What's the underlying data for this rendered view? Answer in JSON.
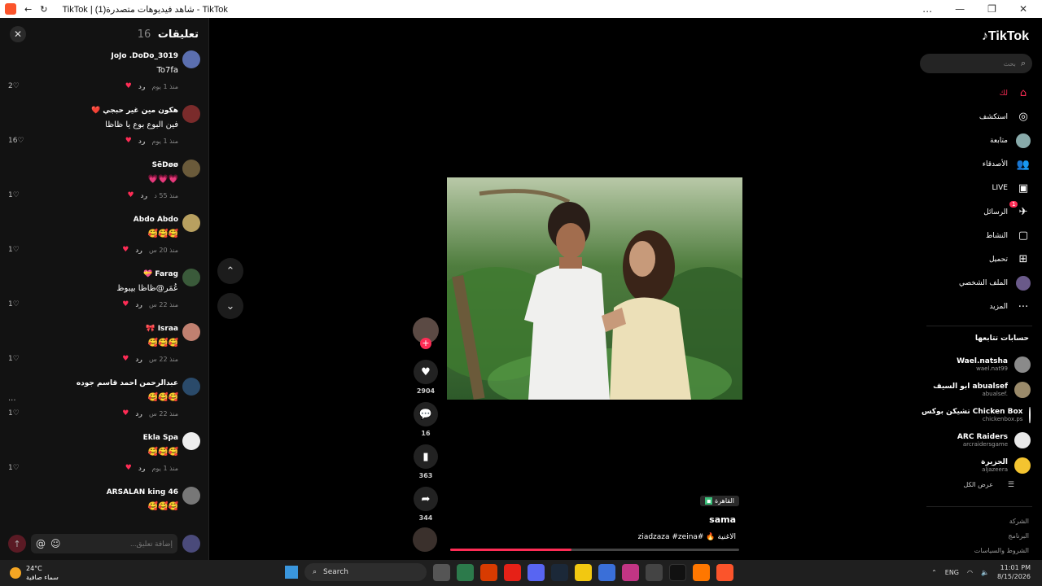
{
  "browser": {
    "title": "TikTok | شاهد فيديوهات متصدرة(1) - TikTok",
    "controls": [
      "…",
      "—",
      "❐",
      "✕"
    ]
  },
  "comments": {
    "title": "تعليقات",
    "count": "16",
    "input_placeholder": "إضافة تعليق...",
    "items": [
      {
        "user": "JoJo .DoDo_3019",
        "text": "To7fa",
        "time": "منذ 1 يوم",
        "reply": "رد",
        "likes": "2",
        "avatar_color": "#5b6fb0"
      },
      {
        "user": "هكون مين غير حبجي ❤️",
        "text": "فين البوع بوع يا ظاظا",
        "time": "منذ 1 يوم",
        "reply": "رد",
        "likes": "16",
        "avatar_color": "#7a2b2b"
      },
      {
        "user": "SēDøø",
        "text": "💗💗💗",
        "time": "منذ 55 د",
        "reply": "رد",
        "likes": "1",
        "avatar_color": "#6a5a3a"
      },
      {
        "user": "Abdo Abdo",
        "text": "🥰🥰🥰",
        "time": "منذ 20 س",
        "reply": "رد",
        "likes": "1",
        "avatar_color": "#b8a060"
      },
      {
        "user": "Farag 💝",
        "text": "عُمَر@ظاظا بيبوظ",
        "time": "منذ 22 س",
        "reply": "رد",
        "likes": "1",
        "avatar_color": "#3a5a3a"
      },
      {
        "user": "Israa 🎀",
        "text": "🥰🥰🥰",
        "time": "منذ 22 س",
        "reply": "رد",
        "likes": "1",
        "avatar_color": "#c08070"
      },
      {
        "user": "عبدالرحمن احمد قاسم جوده",
        "text": "🥰🥰🥰",
        "time": "منذ 22 س",
        "reply": "رد",
        "likes": "1",
        "avatar_color": "#2a4a6a",
        "more": "..."
      },
      {
        "user": "Ekla Spa",
        "text": "🥰🥰🥰",
        "time": "منذ 1 يوم",
        "reply": "رد",
        "likes": "1",
        "avatar_color": "#eeeeee"
      },
      {
        "user": "ARSALAN king 46",
        "text": "🥰🥰🥰",
        "time": "",
        "reply": "",
        "likes": "",
        "avatar_color": "#777777"
      }
    ]
  },
  "video": {
    "location": "القاهرة",
    "author": "sama",
    "caption": "الاغنية 🔥 #ziadzaza #zeina",
    "progress": 0.42,
    "likes": "2904",
    "comments": "16",
    "saves": "363",
    "shares": "344"
  },
  "sidebar": {
    "logo": "TikTok",
    "search_placeholder": "بحث",
    "nav": [
      {
        "label": "لك",
        "icon": "home-icon",
        "glyph": "⌂",
        "active": true
      },
      {
        "label": "استكشف",
        "icon": "compass-icon",
        "glyph": "◎"
      },
      {
        "label": "متابعة",
        "icon": "avatar-icon",
        "glyph": ""
      },
      {
        "label": "الأصدقاء",
        "icon": "friends-icon",
        "glyph": "👥"
      },
      {
        "label": "LIVE",
        "icon": "live-icon",
        "glyph": "▣"
      },
      {
        "label": "الرسائل",
        "icon": "messages-icon",
        "glyph": "✈",
        "badge": "1"
      },
      {
        "label": "النشاط",
        "icon": "activity-icon",
        "glyph": "▢"
      },
      {
        "label": "تحميل",
        "icon": "upload-icon",
        "glyph": "⊞"
      },
      {
        "label": "الملف الشخصي",
        "icon": "profile-icon",
        "glyph": ""
      },
      {
        "label": "المزيد",
        "icon": "more-icon",
        "glyph": "···"
      }
    ],
    "following_title": "حسابات تتابعها",
    "following": [
      {
        "name": "Wael.natsha",
        "handle": "wael.nat99",
        "color": "#8a8a8a"
      },
      {
        "name": "ابو السيف abualsef",
        "handle": "abualsef.",
        "color": "#9a8a6a"
      },
      {
        "name": "تشيكن بوكس Chicken Box",
        "handle": "chickenbox.ps",
        "color": "#f2f2f2"
      },
      {
        "name": "ARC Raiders",
        "handle": "arcraidersgame",
        "color": "#e8e8e8"
      },
      {
        "name": "الجزيرة",
        "handle": "aljazeera",
        "color": "#f4c430"
      }
    ],
    "see_all": "عرض الكل",
    "footer": [
      "الشركة",
      "البرنامج",
      "الشروط والسياسات"
    ]
  },
  "taskbar": {
    "temp": "24°C",
    "weather": "سماء صافية",
    "search": "Search",
    "lang": "ENG",
    "time": "11:01 PM",
    "date": "8/15/2026"
  }
}
